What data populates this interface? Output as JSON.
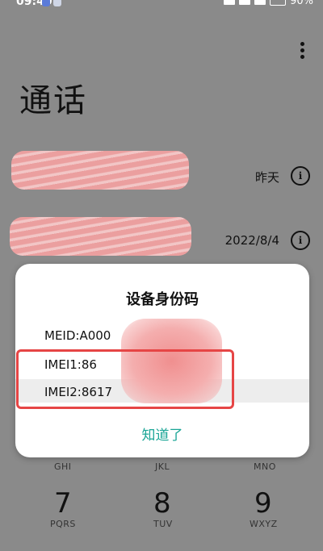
{
  "status_bar": {
    "time": "09:40",
    "battery": "90%"
  },
  "screen": {
    "title": "通话"
  },
  "call_log": [
    {
      "date": "昨天"
    },
    {
      "date": "2022/8/4"
    }
  ],
  "keypad": {
    "letters_row": [
      "GHI",
      "JKL",
      "MNO"
    ],
    "keys": [
      {
        "digit": "7",
        "letters": "PQRS"
      },
      {
        "digit": "8",
        "letters": "TUV"
      },
      {
        "digit": "9",
        "letters": "WXYZ"
      }
    ]
  },
  "dialog": {
    "title": "设备身份码",
    "lines": [
      "MEID:A000",
      "IMEI1:86",
      "IMEI2:8617"
    ],
    "ok_label": "知道了",
    "accent_color": "#1aa596",
    "highlight_color": "#e64545"
  }
}
